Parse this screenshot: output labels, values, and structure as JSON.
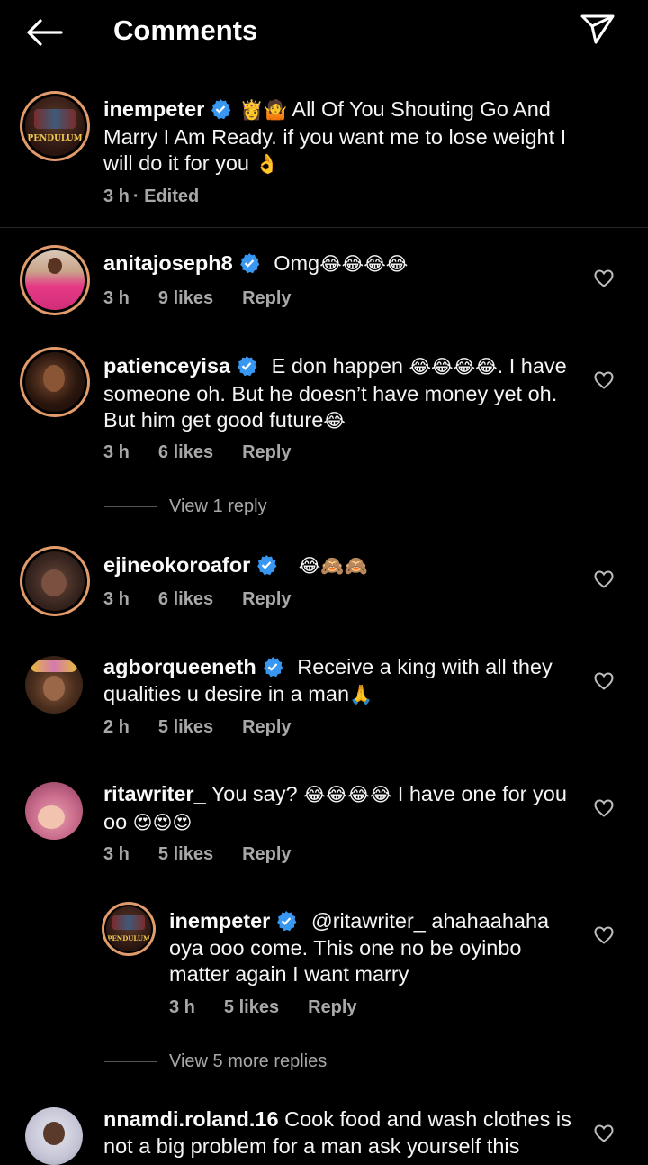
{
  "header": {
    "title": "Comments"
  },
  "caption": {
    "username": "inempeter",
    "text": "All Of You Shouting Go And Marry I Am Ready. if you want me to lose weight I will do it for you",
    "emoji_prefix": "👸🤷",
    "emoji_suffix": "👌",
    "time": "3 h",
    "edited": "· Edited",
    "avatar_text": "PENDULUM"
  },
  "comments": [
    {
      "username": "anitajoseph8",
      "text": "Omg",
      "emoji_suffix": "😂😂😂😂",
      "time": "3 h",
      "likes": "9 likes",
      "reply": "Reply"
    },
    {
      "username": "patienceyisa",
      "text_before": "E don happen",
      "emoji_mid": "😂😂😂😂",
      "text_after": ". I have someone oh. But he doesn’t have money yet oh. But him get good future",
      "emoji_suffix": "😂",
      "time": "3 h",
      "likes": "6 likes",
      "reply": "Reply",
      "view_replies": "View 1 reply"
    },
    {
      "username": "ejineokoroafor",
      "text": "",
      "emoji_suffix": "😂🙈🙈",
      "time": "3 h",
      "likes": "6 likes",
      "reply": "Reply"
    },
    {
      "username": "agborqueeneth",
      "text": "Receive a king with all they qualities u desire in a man",
      "emoji_suffix": "🙏",
      "time": "2 h",
      "likes": "5 likes",
      "reply": "Reply"
    },
    {
      "username": "ritawriter_",
      "text_before": "You say?",
      "emoji_mid": "😂😂😂😂",
      "text_after": "I have one for you oo",
      "emoji_suffix": "😍😍😍",
      "time": "3 h",
      "likes": "5 likes",
      "reply": "Reply"
    }
  ],
  "nested_reply": {
    "username": "inempeter",
    "mention": "@ritawriter_",
    "text": "ahahaahaha oya ooo come. This one no be oyinbo matter again I want marry",
    "time": "3 h",
    "likes": "5 likes",
    "reply": "Reply",
    "view_replies": "View 5 more replies",
    "avatar_text": "PENDULUM"
  },
  "last_comment": {
    "username": "nnamdi.roland.16",
    "text": "Cook food and wash clothes is not a big problem for a man ask yourself this"
  },
  "colors": {
    "background": "#000000",
    "text": "#f5f5f5",
    "meta": "#a8a8a8",
    "verified": "#3897f0",
    "story_ring": "#e29b6b"
  }
}
